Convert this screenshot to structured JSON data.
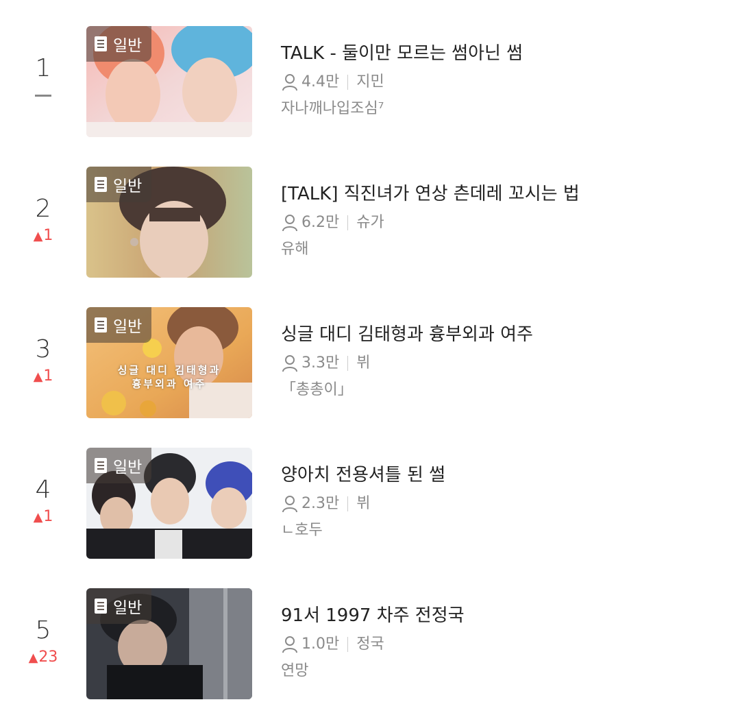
{
  "ranking": [
    {
      "rank": "1",
      "change": "",
      "badge": "일반",
      "title": "TALK - 둘이만 모르는 썸아닌 썸",
      "views": "4.4만",
      "character": "지민",
      "author": "자나깨나입조심⁷",
      "thumb_caption": ""
    },
    {
      "rank": "2",
      "change": "1",
      "badge": "일반",
      "title": "[TALK] 직진녀가 연상 츤데레 꼬시는 법",
      "views": "6.2만",
      "character": "슈가",
      "author": "유해",
      "thumb_caption": ""
    },
    {
      "rank": "3",
      "change": "1",
      "badge": "일반",
      "title": "싱글 대디 김태형과 흉부외과 여주",
      "views": "3.3만",
      "character": "뷔",
      "author": "「총총이」",
      "thumb_caption_line1": "싱글 대디 김태형과",
      "thumb_caption_line2": "흉부외과 여주"
    },
    {
      "rank": "4",
      "change": "1",
      "badge": "일반",
      "title": "양아치 전용셔틀 된 썰",
      "views": "2.3만",
      "character": "뷔",
      "author": "ㄴ호두",
      "thumb_caption": ""
    },
    {
      "rank": "5",
      "change": "23",
      "badge": "일반",
      "title": "91서 1997 차주 전정국",
      "views": "1.0만",
      "character": "정국",
      "author": "연망",
      "thumb_caption": ""
    }
  ],
  "icons": {
    "up": "triangle-up-icon",
    "same": "dash-icon",
    "views": "person-icon",
    "badge": "document-icon"
  },
  "colors": {
    "rank_up": "#f04e4e",
    "meta_text": "#8a8a8a",
    "title_text": "#222222"
  }
}
